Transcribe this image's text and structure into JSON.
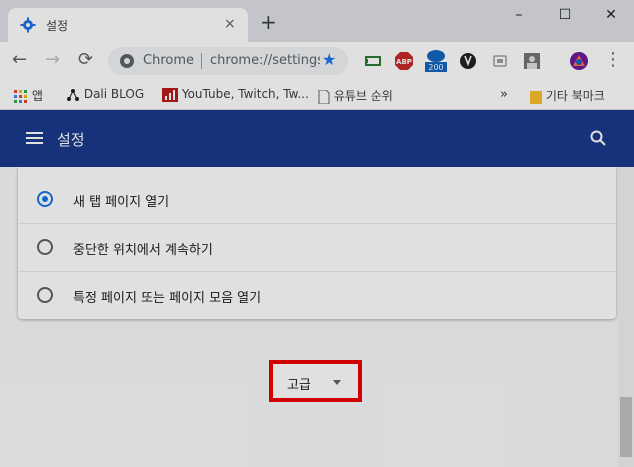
{
  "window": {
    "tab_title": "설정",
    "tab_close_icon": "×",
    "new_tab_icon": "+",
    "minimize_icon": "–",
    "maximize_icon": "☐",
    "close_icon": "✕"
  },
  "toolbar": {
    "back_icon": "←",
    "forward_icon": "→",
    "reload_icon": "⟳",
    "omnibox_site": "Chrome",
    "omnibox_url": "chrome://settings",
    "star_icon": "★",
    "menu_icon": "⋮",
    "extensions": [
      {
        "name": "tag-extension-icon",
        "color": "#2e7d32"
      },
      {
        "name": "adblock-plus-icon",
        "label": "ABP",
        "color": "#c62828"
      },
      {
        "name": "cloud-badge-icon",
        "badge": "200",
        "color": "#1565c0"
      },
      {
        "name": "tool-extension-icon",
        "color": "#212121"
      },
      {
        "name": "screen-extension-icon",
        "color": "#9e9e9e"
      },
      {
        "name": "profile-extension-icon",
        "color": "#757575"
      },
      {
        "name": "avatar-icon",
        "color": "#6a1b9a"
      }
    ]
  },
  "bookmarks": {
    "apps": "앱",
    "items": [
      "Dali BLOG",
      "YouTube, Twitch, Tw...",
      "유튜브 순위"
    ],
    "overflow": "»",
    "other_folder": "기타 북마크"
  },
  "settings": {
    "title": "설정",
    "header_color": "#1a3a8c",
    "startup_options": [
      {
        "label": "새 탭 페이지 열기",
        "checked": true
      },
      {
        "label": "중단한 위치에서 계속하기",
        "checked": false
      },
      {
        "label": "특정 페이지 또는 페이지 모음 열기",
        "checked": false
      }
    ],
    "advanced_label": "고급"
  }
}
